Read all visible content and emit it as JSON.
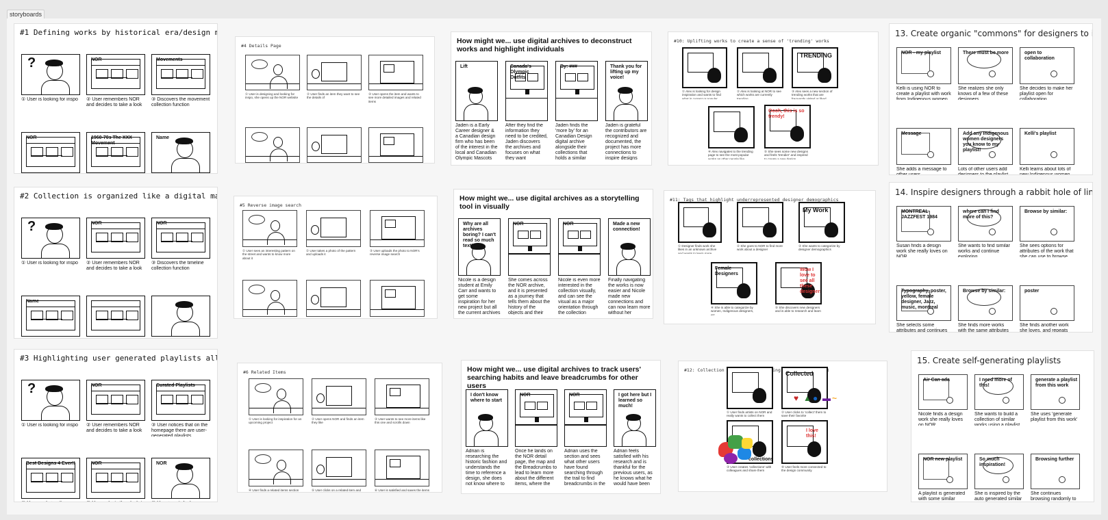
{
  "frame_label": "storyboards",
  "boards": {
    "b1": {
      "title": "#1 Defining works by historical era/design movements",
      "captions": [
        "① User is looking for inspo",
        "② User remembers NOR and decides to take a look",
        "③ Discovers the movement collection function",
        "④ User enjoys exploring the collections and pieces found",
        "⑤ User discovers a piece she likes, clicks to the detail page",
        "⑥ User is satisfied"
      ],
      "panel_text": [
        "NOR",
        "NOR",
        "Movements",
        "NOR",
        "1960-70s The XXX Movement",
        "Name"
      ]
    },
    "b2": {
      "title": "#2 Collection is organized like a digital map",
      "captions": [
        "① User is looking for inspo",
        "② User remembers NOR and decides to take a look",
        "③ Discovers the timeline collection function",
        "④ User enjoys exploring the map and pieces found",
        "⑤ User discovers a piece she likes, clicks to the detail page",
        "⑥ User is satisfied"
      ],
      "panel_text": [
        "NOR",
        "NOR",
        "NOR",
        "Name"
      ]
    },
    "b3": {
      "title": "#3 Highlighting user generated playlists allowing collaboration",
      "captions": [
        "① User is looking for inspo",
        "② User remembers NOR and decides to take a look",
        "③ User notices that on the homepage there are user-generated playlists",
        "④ User exploring the playlists and discovers more designs",
        "⑤ User selects the playlist to add to her board",
        "⑥ User is satisfied"
      ],
      "panel_text": [
        "NOR",
        "NOR",
        "Curated Playlists",
        "Best Designs 4 Ever!!",
        "NOR",
        "NOR",
        "Best Designs 4 Ever!!",
        "SAVED PLAYLISTS"
      ]
    },
    "b4": {
      "title": "#4 Details Page",
      "captions": [
        "① User is designing and looking for inspo, she opens up the NOR website",
        "② User finds an item they want to see the details of",
        "③ User opens the item and wants to see more detailed images and related items",
        "④ User reads the Open Details description about the item",
        "⑤ User looks at the related items",
        "⑥ User is satisfied"
      ]
    },
    "b5": {
      "title": "#5 Reverse image search",
      "captions": [
        "① User sees an interesting pattern on the street and wants to know more about it",
        "② User takes a photo of the pattern and uploads it",
        "③ User uploads the photo to NOR's reverse image search",
        "④ User gets a range of results similar to the photo",
        "⑤ User looks at the results and finds something inspiring",
        "⑥ User is satisfied"
      ]
    },
    "b6": {
      "title": "#6 Related Items",
      "captions": [
        "① User is looking for inspiration for an upcoming project",
        "② User opens NOR and finds an item they like",
        "③ User wants to see more items like this one and scrolls down",
        "④ User finds a related items section below the item details",
        "⑤ User clicks on a related item and finds what they need",
        "⑥ User is satisfied and saves the items"
      ]
    },
    "b7": {
      "title": "How might we... use digital archives to deconstruct works and highlight individuals",
      "captions": [
        "Jaden is a Early Career designer & a Canadian design firm who has been of the interest in the local and Canadian Olympic Mascots for 2022 olympics",
        "After they find the information they need to be credited, Jaden discovers the archives and focuses on what they want",
        "Jaden finds the 'more by' for an Canadian Design digital archive alongside their collections that holds a similar designer and designer",
        "Jaden is grateful the contributors are recognized and documented, the project has more connections to inspire designs"
      ],
      "panel_text": [
        "Lift",
        "Canada's Olympic Outfits",
        "By: ###",
        "Thank you for lifting up my voice!"
      ]
    },
    "b8": {
      "title": "How might we... use digital archives as a storytelling tool in visually",
      "captions": [
        "Nicole is a design student at Emily Carr and wants to get some inspiration for her new project but all the current archives are just so heavy",
        "She comes across the NOR archive, and it is presented as a journey that tells them about the history of the objects and their connection",
        "Nicole is even more interested in the collection visually, and can see the visual as a major orientation through the collection",
        "Finally navigating the works is now easier and Nicole made new connections and can now learn more without her"
      ],
      "panel_text": [
        "Why are all archives boring? I can't read so much text!",
        "NOR",
        "NOR",
        "Made a new connection!"
      ]
    },
    "b9": {
      "title": "How might we... use digital archives to track users' searching habits and leave breadcrumbs for other users",
      "captions": [
        "Adrian is researching the historic fashion and understands the time to reference a design, she does not know where to start, but her search leads to the past records she finds useful",
        "Once he lands on the NOR detail page, the map and the Breadcrumbs to lead to learn more about the different items, where the image is visible and what other designs there are",
        "Adrian uses the section and sees what other users have found searching through the trail to find breadcrumbs in the archive and related works",
        "Adrian feels satisfied with his research and is thankful for the previous users, as he knows what he would have been searching for so long"
      ],
      "panel_text": [
        "I don't know where to start",
        "NOR",
        "NOR",
        "I got here but I learned so much!"
      ]
    },
    "b10": {
      "title": "#10: Uplifting works to create a sense of 'trending' works",
      "captions": [
        "① Alex is looking for design inspiration and wants to find what is current or popular",
        "② Alex is looking at NOR to see which works are currently trending",
        "③ Alex sees a new section of trending works that are frequently visited or liked",
        "④ Alex navigates to the trending page to see the most popular works as other people like",
        "⑤ She sees some new designs and feels 'trendier' and inspired to create a new design"
      ],
      "panel_text": [
        "TRENDING",
        "Oooh, this is so trendy!"
      ]
    },
    "b11": {
      "title": "#11: Tags that highlight underrepresented designer demographics",
      "captions": [
        "① Designer finds work she likes in an unknown archive and wants to learn more",
        "② She goes to NOR to find more work about a designer",
        "③ She wants to categorize by designer demographics",
        "④ She is able to categorize by women, Indigenous designers, etc.",
        "⑤ She discovers new designers and is able to research and learn"
      ],
      "panel_text": [
        "My Work",
        "Tags",
        "Women",
        "Indigenous",
        "Female Designers",
        "Indigenous Artists",
        "Wow I love to see all these designers!"
      ]
    },
    "b12": {
      "title": "#12: Collection & Community building platform with NOR",
      "captions": [
        "① User finds artists on NOR and really wants to collect them",
        "② User clicks to 'collect' them to save their favorite",
        "③ User creates 'collections' with colleagues and share them",
        "④ User feels more connected to the design community"
      ],
      "panel_text": [
        "Collected",
        "collections!",
        "I love this!"
      ]
    },
    "b13": {
      "title": "13. Create organic \"commons\" for designers to interact",
      "captions": [
        "Kelli is using NOR to create a playlist with work from Indigenous women designers",
        "She realizes she only knows of a few of these designers...",
        "She decides to make her playlist open for collaboration",
        "She adds a message to other users",
        "Lots of other users add designers to the playlist",
        "Kelli learns about lots of new Indigenous women designers and finds new inspiration"
      ],
      "panel_text": [
        "NOR - my playlist",
        "There must be more",
        "open to collaboration",
        "Message",
        "Add any Indigenous women designers you know to my playlist!",
        "Kelli's playlist",
        "+ CONTRIBUTE",
        "NOR - my playlist"
      ]
    },
    "b14": {
      "title": "14. Inspire designers through a rabbit hole of links",
      "captions": [
        "Susan finds a design work she really loves on NOR",
        "She wants to find similar works and continue exploring",
        "She sees options for attributes of the work that she can use to browse the collection",
        "She selects some attributes and continues browsing",
        "She finds more works with the same attributes to explore",
        "She finds another work she loves, and repeats the process again!"
      ],
      "panel_text": [
        "MONTREAL JAZZFEST 1984",
        "where can I find more of this?",
        "Browse by similar:",
        "Typography, poster, yellow, female designer, Jazz, music, montreal",
        "Browse by similar:",
        "poster",
        "yellow",
        "montreal",
        "BROWSE",
        "NOR",
        "WHAT JAZZ ALL"
      ]
    },
    "b15": {
      "title": "15. Create self-generating playlists",
      "captions": [
        "Nicole finds a design work she really loves on NOR",
        "She wants to build a collection of similar works using a playlist",
        "She uses 'generate playlist from this work'",
        "A playlist is generated with some similar works, determined by attributes like color, medium, era, designer, and also included another playlist with the original work",
        "She is inspired by the auto generated similar works, notices a good start to her collection",
        "She continues browsing randomly to dive deeper and explores and finds ways to add to her collection"
      ],
      "panel_text": [
        "Air Can ada",
        "I need more of this!",
        "generate a playlist from this work",
        "NOR new playlist",
        "So much inspiration!",
        "Browsing further"
      ]
    }
  }
}
